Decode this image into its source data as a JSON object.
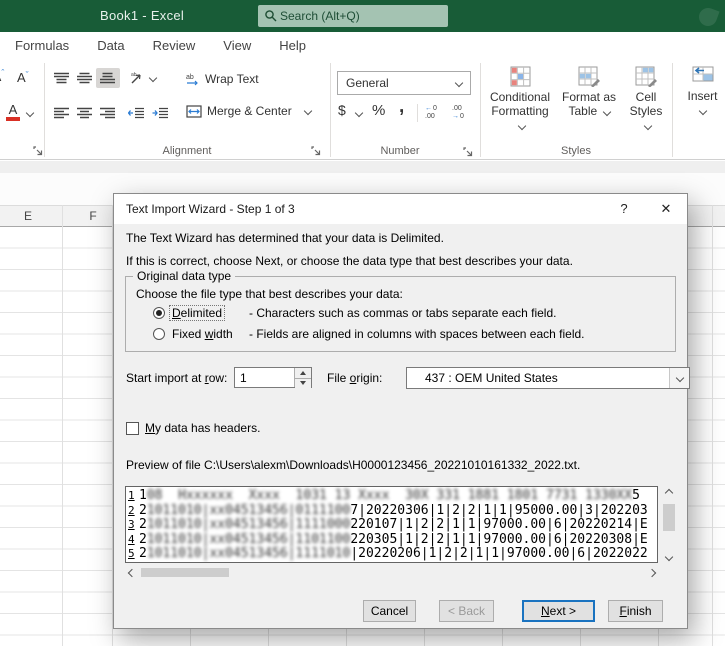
{
  "titlebar": {
    "title": "Book1  -  Excel",
    "search_placeholder": "Search (Alt+Q)"
  },
  "ribbon": {
    "tabs": [
      {
        "label": "Formulas"
      },
      {
        "label": "Data"
      },
      {
        "label": "Review"
      },
      {
        "label": "View"
      },
      {
        "label": "Help"
      }
    ],
    "alignment": {
      "wrap_text": "Wrap Text",
      "merge_center": "Merge & Center",
      "group_label": "Alignment"
    },
    "number": {
      "format_value": "General",
      "dollar": "$",
      "percent": "%",
      "comma": ",",
      "group_label": "Number"
    },
    "styles": {
      "conditional_line1": "Conditional",
      "conditional_line2": "Formatting",
      "format_table_line1": "Format as",
      "format_table_line2": "Table",
      "cell_styles_line1": "Cell",
      "cell_styles_line2": "Styles",
      "group_label": "Styles"
    },
    "insert_label": "Insert"
  },
  "sheet": {
    "column_e": "E",
    "column_f": "F"
  },
  "dialog": {
    "title": "Text Import Wizard - Step 1 of 3",
    "help_glyph": "?",
    "close_glyph": "✕",
    "intro_line1": "The Text Wizard has determined that your data is Delimited.",
    "intro_line2": "If this is correct, choose Next, or choose the data type that best describes your data.",
    "group": {
      "legend": "Original data type",
      "prompt": "Choose the file type that best describes your data:",
      "delimited": {
        "u": "D",
        "rest": "elimited",
        "desc": "- Characters such as commas or tabs separate each field."
      },
      "fixed": {
        "pre": "Fixed ",
        "u": "w",
        "rest": "idth",
        "desc": "- Fields are aligned in columns with spaces between each field."
      }
    },
    "start_row": {
      "pre": "Start import at ",
      "u": "r",
      "rest": "ow:",
      "value": "1"
    },
    "file_origin": {
      "pre": "File ",
      "u": "o",
      "rest": "rigin:",
      "value": "437 : OEM United States"
    },
    "headers": {
      "u": "M",
      "rest": "y data has headers."
    },
    "preview_label": "Preview of file C:\\Users\\alexm\\Downloads\\H0000123456_20221010161332_2022.txt.",
    "preview_rows": [
      {
        "num": "1",
        "lead": "1",
        "blurred": "08  Hxxxxxx  Xxxx  1031 13 Xxxx  30X 331 1881 1801 7731 1330XX",
        "tail": "5"
      },
      {
        "num": "2",
        "lead": "2",
        "blurred": "1011010|xx04513456|0111100",
        "tail": "7|20220306|1|2|2|1|1|95000.00|3|202203"
      },
      {
        "num": "3",
        "lead": "2",
        "blurred": "1011010|xx04513456|1111000",
        "tail": "220107|1|2|2|1|1|97000.00|6|20220214|E"
      },
      {
        "num": "4",
        "lead": "2",
        "blurred": "1011010|xx04513456|1101100",
        "tail": "220305|1|2|2|1|1|97000.00|6|20220308|E"
      },
      {
        "num": "5",
        "lead": "2",
        "blurred": "1011010|xx04513456|1111010",
        "tail": "|20220206|1|2|2|1|1|97000.00|6|2022022"
      }
    ],
    "buttons": {
      "cancel": "Cancel",
      "back": "< Back",
      "next": {
        "u": "N",
        "rest": "ext >"
      },
      "finish": {
        "u": "F",
        "rest": "inish"
      }
    }
  }
}
